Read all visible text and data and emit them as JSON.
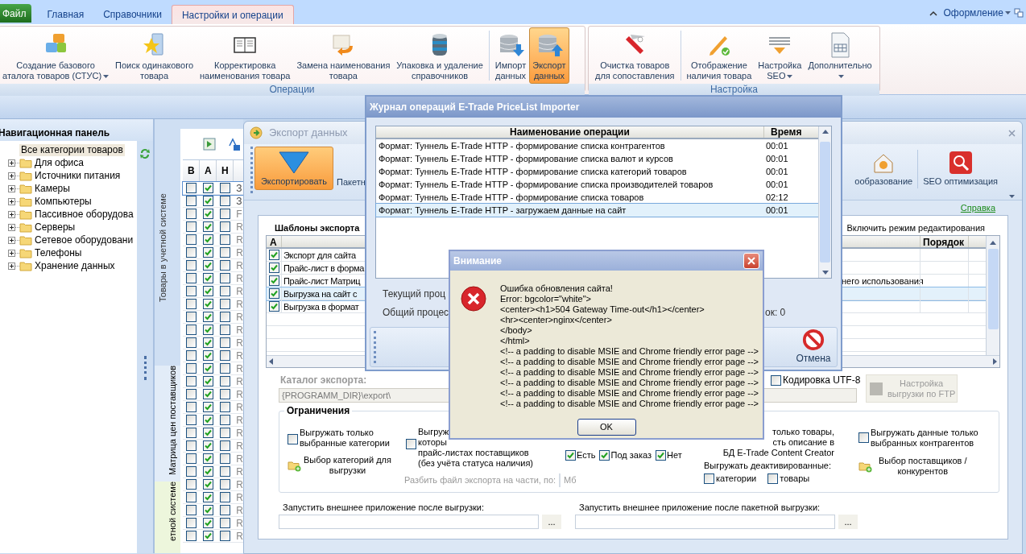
{
  "ribbon": {
    "app_button": "Файл",
    "tabs": [
      {
        "label": "Главная",
        "selected": false
      },
      {
        "label": "Справочники",
        "selected": false
      },
      {
        "label": "Настройки и операции",
        "selected": true
      }
    ],
    "right_menu": "Оформление",
    "groups": [
      {
        "title": "Операции",
        "buttons": [
          {
            "label": "Создание базового\nаталога товаров (СТУС)",
            "dropdown": true,
            "selected": false
          },
          {
            "label": "Поиск одинакового\nтовара",
            "dropdown": false,
            "selected": false
          },
          {
            "label": "Корректировка\nнаименования товара",
            "dropdown": false,
            "selected": false
          },
          {
            "label": "Замена наименования\nтовара",
            "dropdown": false,
            "selected": false
          },
          {
            "label": "Упаковка и удаление\nсправочников",
            "dropdown": false,
            "selected": false
          },
          {
            "label": "Импорт\nданных",
            "dropdown": false,
            "selected": false
          },
          {
            "label": "Экспорт\nданных",
            "dropdown": false,
            "selected": true
          }
        ]
      },
      {
        "title": "Настройка",
        "buttons": [
          {
            "label": "Очистка товаров\nдля сопоставления",
            "dropdown": false,
            "selected": false
          },
          {
            "label": "Отображение\nналичия товара",
            "dropdown": false,
            "selected": false
          },
          {
            "label": "Настройка\nSEO",
            "dropdown": true,
            "selected": false
          },
          {
            "label": "Дополнительно",
            "dropdown": true,
            "selected": false
          }
        ]
      }
    ]
  },
  "nav_panel": {
    "title": "Навигационная панель",
    "tree": [
      {
        "label": "Все категории товаров",
        "selected": true,
        "children": [
          {
            "label": "Для офиса",
            "expanded": false
          },
          {
            "label": "Источники питания",
            "expanded": false
          },
          {
            "label": "Камеры",
            "expanded": false
          },
          {
            "label": "Компьютеры",
            "expanded": false
          },
          {
            "label": "Пассивное оборудова",
            "expanded": false
          },
          {
            "label": "Серверы",
            "expanded": false
          },
          {
            "label": "Сетевое оборудовани",
            "expanded": false
          },
          {
            "label": "Телефоны",
            "expanded": false
          },
          {
            "label": "Хранение данных",
            "expanded": false
          }
        ]
      }
    ]
  },
  "side_tabs": [
    {
      "label": "Товары в учетной системе",
      "selected": false
    },
    {
      "label": "Матрица цен поставщиков",
      "selected": false
    },
    {
      "label": "етной системе",
      "selected": true
    }
  ],
  "grid": {
    "columns": [
      "В",
      "А",
      "Н"
    ],
    "rows": [
      {
        "b": false,
        "a": true,
        "h": false,
        "text": "З",
        "selected": true
      },
      {
        "b": false,
        "a": true,
        "h": false,
        "text": "З",
        "selected": false
      },
      {
        "b": false,
        "a": true,
        "h": false,
        "text": "F",
        "selected": false
      },
      {
        "b": false,
        "a": true,
        "h": false,
        "text": "R",
        "selected": false
      },
      {
        "b": false,
        "a": true,
        "h": false,
        "text": "R",
        "selected": false
      },
      {
        "b": false,
        "a": true,
        "h": false,
        "text": "R",
        "selected": false
      },
      {
        "b": false,
        "a": true,
        "h": false,
        "text": "R",
        "selected": false
      },
      {
        "b": false,
        "a": true,
        "h": false,
        "text": "R",
        "selected": false
      },
      {
        "b": false,
        "a": true,
        "h": false,
        "text": "R",
        "selected": false
      },
      {
        "b": false,
        "a": true,
        "h": false,
        "text": "R",
        "selected": false
      },
      {
        "b": false,
        "a": true,
        "h": false,
        "text": "R",
        "selected": false
      },
      {
        "b": false,
        "a": true,
        "h": false,
        "text": "R",
        "selected": false
      },
      {
        "b": false,
        "a": true,
        "h": false,
        "text": "R",
        "selected": false
      },
      {
        "b": false,
        "a": true,
        "h": false,
        "text": "R",
        "selected": false
      },
      {
        "b": false,
        "a": true,
        "h": false,
        "text": "R",
        "selected": false
      },
      {
        "b": false,
        "a": true,
        "h": false,
        "text": "R",
        "selected": false
      },
      {
        "b": false,
        "a": true,
        "h": false,
        "text": "R",
        "selected": false
      },
      {
        "b": false,
        "a": true,
        "h": false,
        "text": "R",
        "selected": false
      },
      {
        "b": false,
        "a": true,
        "h": false,
        "text": "R",
        "selected": false
      },
      {
        "b": false,
        "a": true,
        "h": false,
        "text": "R",
        "selected": false
      },
      {
        "b": false,
        "a": true,
        "h": false,
        "text": "R",
        "selected": false
      },
      {
        "b": false,
        "a": true,
        "h": false,
        "text": "R",
        "selected": false
      },
      {
        "b": false,
        "a": true,
        "h": false,
        "text": "R",
        "selected": false
      },
      {
        "b": false,
        "a": true,
        "h": false,
        "text": "R",
        "selected": false
      },
      {
        "b": false,
        "a": true,
        "h": false,
        "text": "R",
        "selected": false
      },
      {
        "b": false,
        "a": true,
        "h": false,
        "text": "R",
        "selected": false
      },
      {
        "b": false,
        "a": true,
        "h": false,
        "text": "R",
        "selected": false
      },
      {
        "b": false,
        "a": true,
        "h": false,
        "text": "R",
        "selected": false
      }
    ]
  },
  "export_window": {
    "title": "Экспорт данных",
    "toolbar": [
      {
        "label": "Экспортировать",
        "selected": true
      },
      {
        "label": "Пакетн",
        "selected": false
      },
      {
        "label": "ообразование",
        "selected": false
      },
      {
        "label": "SEO оптимизация",
        "selected": false
      }
    ],
    "help_link": "Справка",
    "templates": {
      "title": "Шаблоны экспорта",
      "edit_mode_label": "Включить режим редактирования",
      "columns": [
        "A",
        "Порядок"
      ],
      "rows": [
        {
          "checked": true,
          "name": "Экспорт для сайта",
          "selected": false
        },
        {
          "checked": true,
          "name": "Прайс-лист в форма",
          "selected": false
        },
        {
          "checked": true,
          "name": "Прайс-лист Матриц",
          "note": "него использования",
          "selected": false
        },
        {
          "checked": true,
          "name": "Выгрузка на сайт с",
          "selected": true
        },
        {
          "checked": true,
          "name": "Выгрузка в формат",
          "selected": false
        }
      ]
    },
    "catalog": {
      "label": "Каталог экспорта:",
      "value": "{PROGRAMM_DIR}\\export\\",
      "utf8": {
        "label": "Кодировка UTF-8",
        "checked": false
      },
      "ftp_button": "Настройка\nвыгрузки по FTP"
    },
    "limits": {
      "title": "Ограничения",
      "only_categories": {
        "label": "Выгружать только\nвыбранные категории",
        "checked": false
      },
      "choose_categories": "Выбор категорий для\nвыгрузки",
      "supplier_filter": {
        "lines": [
          "Выгруж",
          "которы",
          "прайс-листах поставщиков",
          "(без учёта статуса наличия)"
        ],
        "checked": false
      },
      "statuses": [
        {
          "label": "Есть",
          "checked": true
        },
        {
          "label": "Под заказ",
          "checked": true
        },
        {
          "label": "Нет",
          "checked": true
        }
      ],
      "split": {
        "label": "Разбить файл экспорта на части, по:",
        "unit": "Мб"
      },
      "described": {
        "lines": [
          "только товары,",
          "сть описание в",
          "БД E-Trade Content Creator"
        ]
      },
      "deactivated": {
        "label": "Выгружать деактивированные:",
        "options": [
          {
            "label": "категории",
            "checked": false
          },
          {
            "label": "товары",
            "checked": false
          }
        ]
      },
      "only_contractors": {
        "label": "Выгружать данные только\nвыбранных контрагентов",
        "checked": false
      },
      "choose_suppliers": "Выбор поставщиков /\nконкурентов"
    },
    "run_after": [
      {
        "label": "Запустить внешнее приложение после выгрузки:",
        "button": "..."
      },
      {
        "label": "Запустить внешнее приложение после пакетной выгрузки:",
        "button": "..."
      }
    ]
  },
  "journal": {
    "title": "Журнал операций E-Trade PriceList Importer",
    "columns": [
      "Наименование операции",
      "Время"
    ],
    "rows": [
      {
        "name": "Формат: Туннель E-Trade HTTP - формирование списка контрагентов",
        "time": "00:01",
        "selected": false
      },
      {
        "name": "Формат: Туннель E-Trade HTTP - формирование списка валют и курсов",
        "time": "00:01",
        "selected": false
      },
      {
        "name": "Формат: Туннель E-Trade HTTP - формирование списка категорий товаров",
        "time": "00:01",
        "selected": false
      },
      {
        "name": "Формат: Туннель E-Trade HTTP - формирование списка производителей товаров",
        "time": "00:01",
        "selected": false
      },
      {
        "name": "Формат: Туннель E-Trade HTTP - формирование списка товаров",
        "time": "02:12",
        "selected": false
      },
      {
        "name": "Формат: Туннель E-Trade HTTP - загружаем данные на сайт",
        "time": "00:01",
        "selected": true
      }
    ],
    "current_label": "Текущий проц",
    "total_label": "Общий процес",
    "errors_label": "ок: 0",
    "cancel_button": "Отмена"
  },
  "alert": {
    "title": "Внимание",
    "lines": [
      "Ошибка обновления сайта!",
      "Error: bgcolor=\"white\">",
      "<center><h1>504 Gateway Time-out</h1></center>",
      "<hr><center>nginx</center>",
      "</body>",
      "</html>",
      "<!-- a padding to disable MSIE and Chrome friendly error page -->",
      "<!-- a padding to disable MSIE and Chrome friendly error page -->",
      "<!-- a padding to disable MSIE and Chrome friendly error page -->",
      "<!-- a padding to disable MSIE and Chrome friendly error page -->",
      "<!-- a padding to disable MSIE and Chrome friendly error page -->",
      "<!-- a padding to disable MSIE and Chrome friendly error page -->"
    ],
    "ok_button": "OK"
  }
}
